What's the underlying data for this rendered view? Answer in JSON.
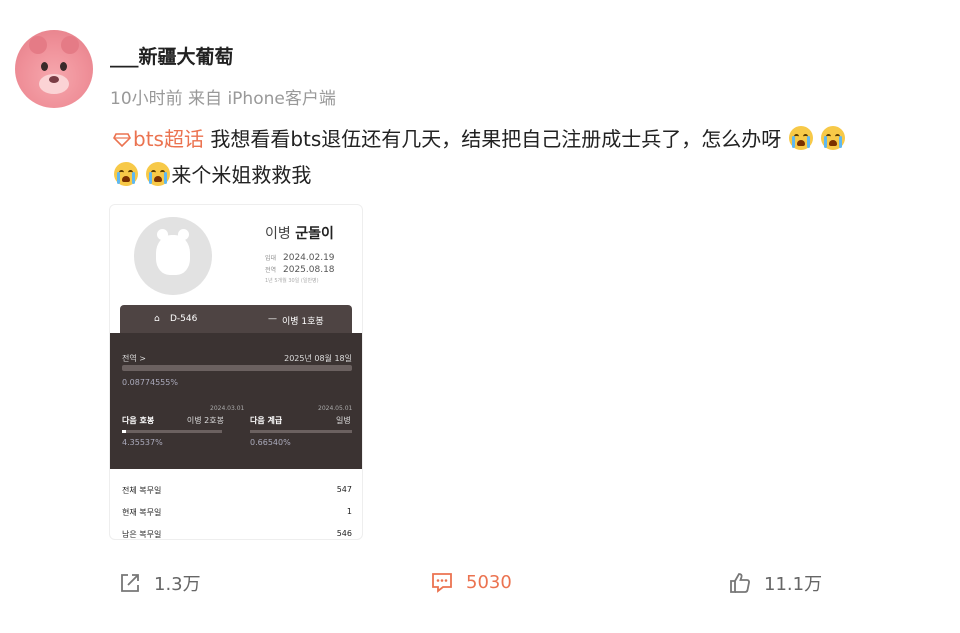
{
  "post": {
    "username": "___新疆大葡萄",
    "meta": "10小时前  来自 iPhone客户端",
    "topic": "bts超话",
    "text_line1": "我想看看bts退伍还有几天，结果把自己注册成士兵了，怎么办呀",
    "text_line2": "来个米姐救救我"
  },
  "card": {
    "rank": "이병",
    "name": "군돌이",
    "enlist_key": "입대",
    "enlist_date": "2024.02.19",
    "discharge_key": "전역",
    "discharge_date": "2025.08.18",
    "period_note": "1년 5개월 30일 (일반병)",
    "dday": "D-546",
    "grade": "이병 1호봉",
    "discharge_label": "전역 >",
    "discharge_full": "2025년 08월 18일",
    "progress_pct": "0.08774555%",
    "next_step_label": "다음 호봉",
    "next_step_date": "2024.03.01",
    "next_step_value": "이병 2호봉",
    "next_step_pct": "4.35537%",
    "next_rank_label": "다음 계급",
    "next_rank_date": "2024.05.01",
    "next_rank_value": "일병",
    "next_rank_pct": "0.66540%",
    "total_label": "전체 복무일",
    "total_value": "547",
    "current_label": "현재 복무일",
    "current_value": "1",
    "remain_label": "남은 복무일",
    "remain_value": "546"
  },
  "actions": {
    "share_count": "1.3万",
    "comment_count": "5030",
    "like_count": "11.1万"
  },
  "colors": {
    "topic": "#eb7350",
    "muted": "#999999"
  }
}
